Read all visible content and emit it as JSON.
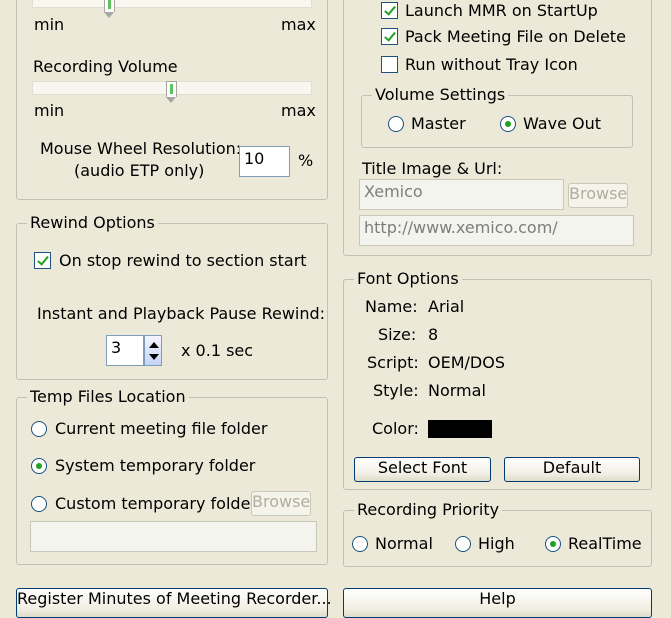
{
  "left": {
    "slider1": {
      "min": "min",
      "max": "max",
      "value_pct": 0.26
    },
    "recording_volume": {
      "label": "Recording Volume",
      "min": "min",
      "max": "max",
      "value_pct": 0.49
    },
    "mouse_wheel": {
      "label_line1": "Mouse Wheel Resolution:",
      "label_line2": "(audio ETP only)",
      "value": "10",
      "unit": "%"
    },
    "rewind": {
      "title": "Rewind Options",
      "on_stop_label": "On stop rewind to section start",
      "on_stop_checked": true,
      "pause_label": "Instant and Playback Pause Rewind:",
      "pause_value": "3",
      "pause_unit": "x 0.1 sec"
    },
    "temp": {
      "title": "Temp Files Location",
      "options": [
        "Current meeting file folder",
        "System temporary folder",
        "Custom temporary folder"
      ],
      "selected": 1,
      "browse_label": "Browse",
      "custom_path": ""
    },
    "register_label": "Register Minutes of Meeting Recorder..."
  },
  "right": {
    "launch_label": "Launch MMR on StartUp",
    "launch_checked": true,
    "pack_label": "Pack Meeting File on Delete",
    "pack_checked": true,
    "tray_label": "Run without Tray Icon",
    "tray_checked": false,
    "volume": {
      "title": "Volume Settings",
      "master": "Master",
      "wave": "Wave Out",
      "selected": "wave"
    },
    "title_image": {
      "label": "Title Image & Url:",
      "name": "Xemico",
      "browse_label": "Browse",
      "url": "http://www.xemico.com/"
    },
    "font": {
      "title": "Font Options",
      "name_label": "Name:",
      "name_value": "Arial",
      "size_label": "Size:",
      "size_value": "8",
      "script_label": "Script:",
      "script_value": "OEM/DOS",
      "style_label": "Style:",
      "style_value": "Normal",
      "color_label": "Color:",
      "color_value": "#000000",
      "select_label": "Select Font",
      "default_label": "Default"
    },
    "priority": {
      "title": "Recording Priority",
      "options": [
        "Normal",
        "High",
        "RealTime"
      ],
      "selected": 2
    },
    "help_label": "Help"
  }
}
